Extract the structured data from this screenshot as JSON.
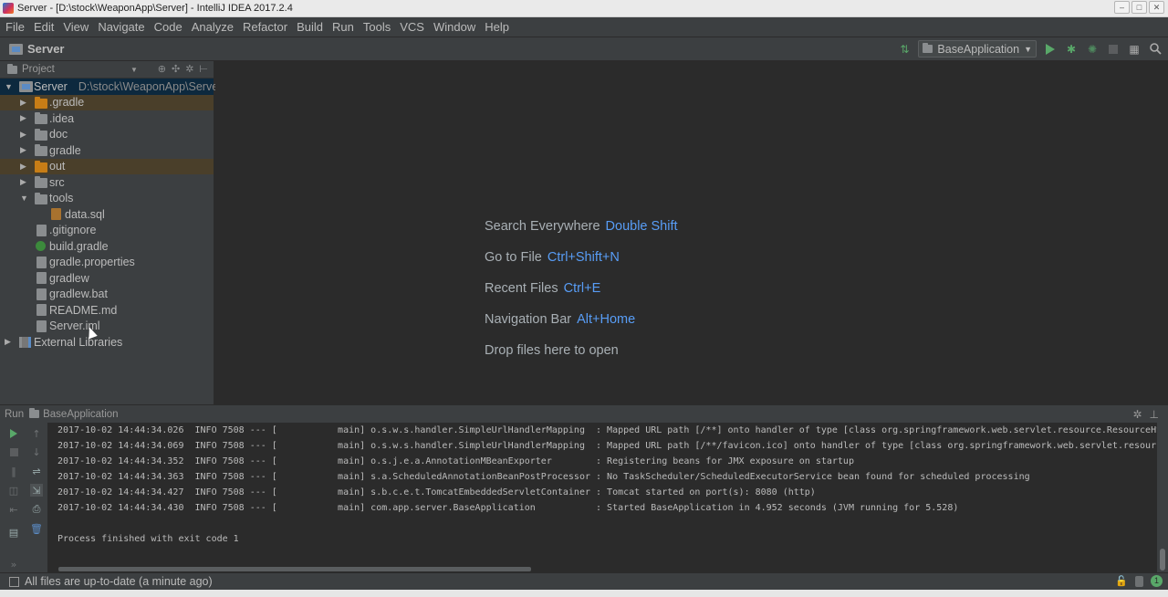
{
  "window": {
    "title": "Server - [D:\\stock\\WeaponApp\\Server] - IntelliJ IDEA 2017.2.4"
  },
  "menu": [
    "File",
    "Edit",
    "View",
    "Navigate",
    "Code",
    "Analyze",
    "Refactor",
    "Build",
    "Run",
    "Tools",
    "VCS",
    "Window",
    "Help"
  ],
  "navbar": {
    "crumb": "Server",
    "run_config": "BaseApplication"
  },
  "project_panel": {
    "title": "Project",
    "root": {
      "name": "Server",
      "path": "D:\\stock\\WeaponApp\\Server"
    },
    "items": [
      {
        "label": ".gradle"
      },
      {
        "label": ".idea"
      },
      {
        "label": "doc"
      },
      {
        "label": "gradle"
      },
      {
        "label": "out"
      },
      {
        "label": "src"
      },
      {
        "label": "tools"
      },
      {
        "label": "data.sql"
      },
      {
        "label": ".gitignore"
      },
      {
        "label": "build.gradle"
      },
      {
        "label": "gradle.properties"
      },
      {
        "label": "gradlew"
      },
      {
        "label": "gradlew.bat"
      },
      {
        "label": "README.md"
      },
      {
        "label": "Server.iml"
      },
      {
        "label": "External Libraries"
      }
    ]
  },
  "editor_hints": [
    {
      "text": "Search Everywhere",
      "key": "Double Shift"
    },
    {
      "text": "Go to File",
      "key": "Ctrl+Shift+N"
    },
    {
      "text": "Recent Files",
      "key": "Ctrl+E"
    },
    {
      "text": "Navigation Bar",
      "key": "Alt+Home"
    },
    {
      "text": "Drop files here to open",
      "key": ""
    }
  ],
  "run_panel": {
    "label": "Run",
    "tab": "BaseApplication",
    "lines": [
      "2017-10-02 14:44:34.026  INFO 7508 --- [           main] o.s.w.s.handler.SimpleUrlHandlerMapping  : Mapped URL path [/**] onto handler of type [class org.springframework.web.servlet.resource.ResourceHttpRequestHandler]",
      "2017-10-02 14:44:34.069  INFO 7508 --- [           main] o.s.w.s.handler.SimpleUrlHandlerMapping  : Mapped URL path [/**/favicon.ico] onto handler of type [class org.springframework.web.servlet.resource.ResourceHttpRequestHandler]",
      "2017-10-02 14:44:34.352  INFO 7508 --- [           main] o.s.j.e.a.AnnotationMBeanExporter        : Registering beans for JMX exposure on startup",
      "2017-10-02 14:44:34.363  INFO 7508 --- [           main] s.a.ScheduledAnnotationBeanPostProcessor : No TaskScheduler/ScheduledExecutorService bean found for scheduled processing",
      "2017-10-02 14:44:34.427  INFO 7508 --- [           main] s.b.c.e.t.TomcatEmbeddedServletContainer : Tomcat started on port(s): 8080 (http)",
      "2017-10-02 14:44:34.430  INFO 7508 --- [           main] com.app.server.BaseApplication           : Started BaseApplication in 4.952 seconds (JVM running for 5.528)",
      "",
      "Process finished with exit code 1"
    ]
  },
  "status": {
    "text": "All files are up-to-date (a minute ago)"
  }
}
